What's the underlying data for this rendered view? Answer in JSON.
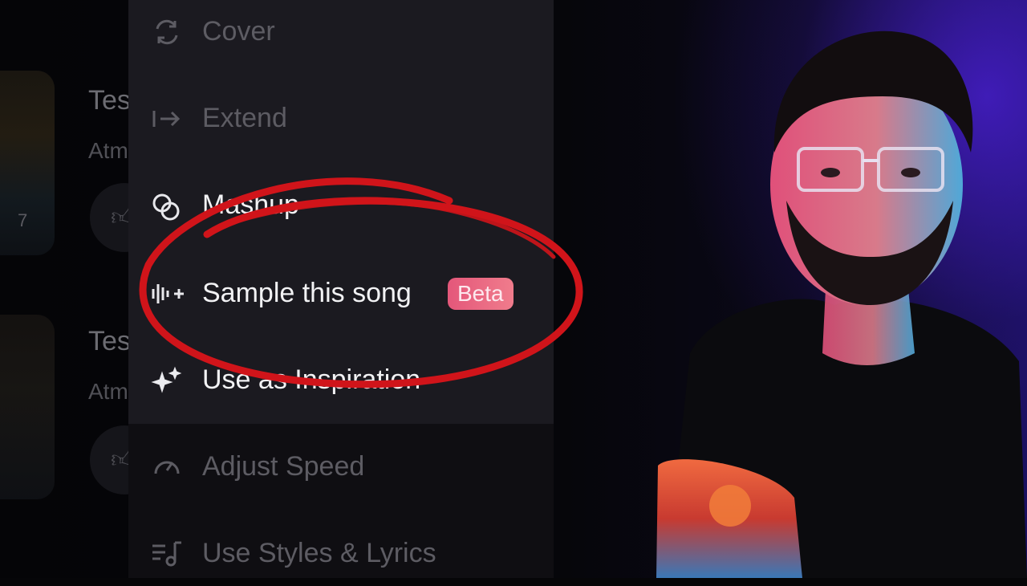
{
  "background_songs": [
    {
      "title_fragment": "Tes",
      "subtitle_fragment": "Atm",
      "number": "7"
    },
    {
      "title_fragment": "Tes",
      "subtitle_fragment": "Atm"
    }
  ],
  "menu": {
    "items": [
      {
        "label": "Cover",
        "icon": "cover-icon"
      },
      {
        "label": "Extend",
        "icon": "extend-arrow-icon"
      },
      {
        "label": "Mashup",
        "icon": "mashup-circles-icon"
      },
      {
        "label": "Sample this song",
        "icon": "waveform-plus-icon",
        "badge": "Beta"
      },
      {
        "label": "Use as Inspiration",
        "icon": "sparkle-icon"
      },
      {
        "label": "Adjust Speed",
        "icon": "speedometer-icon"
      },
      {
        "label": "Use Styles & Lyrics",
        "icon": "lyrics-note-icon"
      }
    ]
  },
  "colors": {
    "annotation": "#d0141a",
    "badge": "#e85a78",
    "menu_bg": "#1b1a20",
    "glow": "#3a1ec8"
  }
}
